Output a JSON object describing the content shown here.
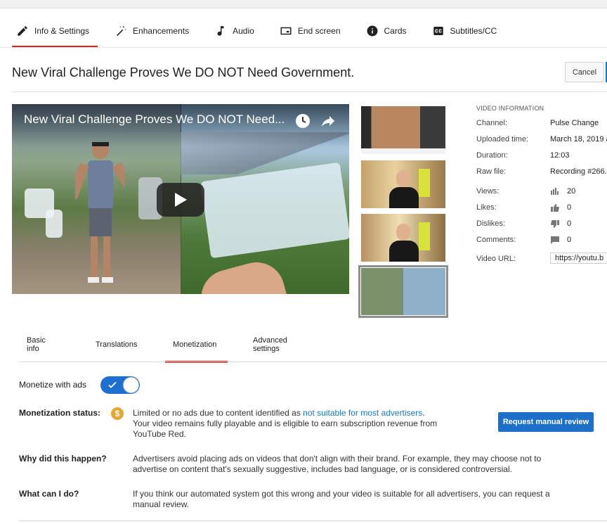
{
  "top_tabs": [
    {
      "label": "Info & Settings",
      "icon": "pencil-icon",
      "active": true
    },
    {
      "label": "Enhancements",
      "icon": "magic-wand-icon",
      "active": false
    },
    {
      "label": "Audio",
      "icon": "music-note-icon",
      "active": false
    },
    {
      "label": "End screen",
      "icon": "end-screen-icon",
      "active": false
    },
    {
      "label": "Cards",
      "icon": "info-circle-icon",
      "active": false
    },
    {
      "label": "Subtitles/CC",
      "icon": "cc-icon",
      "active": false
    }
  ],
  "video": {
    "title": "New Viral Challenge Proves We DO NOT Need Government.",
    "player_title": "New Viral Challenge Proves We DO NOT Need..."
  },
  "actions": {
    "cancel_label": "Cancel"
  },
  "info": {
    "heading": "VIDEO INFORMATION",
    "channel_label": "Channel:",
    "channel": "Pulse Change",
    "uploaded_label": "Uploaded time:",
    "uploaded": "March 18, 2019 a",
    "duration_label": "Duration:",
    "duration": "12:03",
    "rawfile_label": "Raw file:",
    "rawfile": "Recording #266.",
    "views_label": "Views:",
    "views": "20",
    "likes_label": "Likes:",
    "likes": "0",
    "dislikes_label": "Dislikes:",
    "dislikes": "0",
    "comments_label": "Comments:",
    "comments": "0",
    "url_label": "Video URL:",
    "url": "https://youtu.b"
  },
  "bottom_tabs": [
    {
      "label": "Basic info",
      "active": false
    },
    {
      "label": "Translations",
      "active": false
    },
    {
      "label": "Monetization",
      "active": true,
      "warning": true
    },
    {
      "label": "Advanced settings",
      "active": false
    }
  ],
  "monetization": {
    "toggle_label": "Monetize with ads",
    "toggle_on": true,
    "status_label": "Monetization status:",
    "status_text_1": "Limited or no ads due to content identified as ",
    "status_link": "not suitable for most advertisers",
    "status_text_2": ".",
    "status_line_2": "Your video remains fully playable and is eligible to earn subscription revenue from",
    "status_line_3": "YouTube Red.",
    "review_button": "Request manual review",
    "why_label": "Why did this happen?",
    "why_line_1": "Advertisers avoid placing ads on videos that don't align with their brand. For example, they may choose not to",
    "why_line_2": "advertise on content that's sexually suggestive, includes bad language, or is considered controversial.",
    "what_label": "What can I do?",
    "what_line_1": "If you think our automated system got this wrong and your video is suitable for all advertisers, you can request a",
    "what_line_2": "manual review."
  },
  "colors": {
    "accent_red": "#e62117",
    "link_blue": "#167ac6",
    "button_blue": "#1c70c9",
    "toggle_blue": "#1f6fd1",
    "warning_yellow": "#f4c20d"
  }
}
